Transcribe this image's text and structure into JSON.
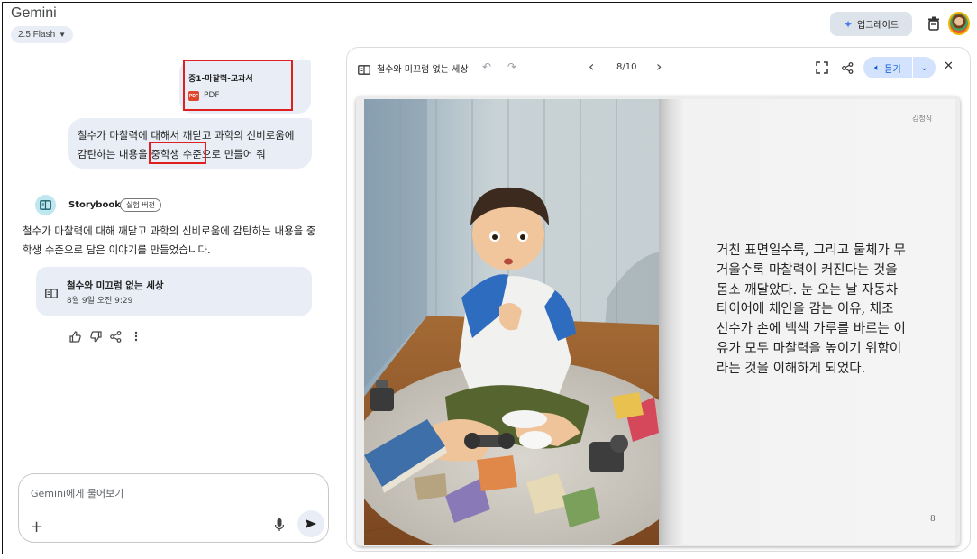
{
  "header": {
    "app_title": "Gemini",
    "model": "2.5 Flash",
    "upgrade_label": "업그레이드"
  },
  "chat": {
    "attachment": {
      "name": "중1-마찰력-교과서",
      "type": "PDF"
    },
    "user_prompt": "철수가 마찰력에 대해서 깨닫고 과학의 신비로움에 감탄하는 내용을 중학생 수준으로 만들어 줘",
    "assistant_name": "Storybook",
    "assistant_badge": "실험 버전",
    "response": "철수가 마찰력에 대해 깨닫고 과학의 신비로움에 감탄하는 내용을 중학생 수준으로 담은 이야기를 만들었습니다.",
    "story_card": {
      "title": "철수와 미끄럼 없는 세상",
      "date": "8월 9일 오전 9:29"
    },
    "input_placeholder": "Gemini에게 물어보기"
  },
  "viewer": {
    "story_title": "철수와 미끄럼 없는 세상",
    "page_indicator": "8/10",
    "listen_label": "듣기",
    "author": "김정식",
    "page_text": "거친 표면일수록, 그리고 물체가 무거울수록 마찰력이 커진다는 것을 몸소 깨달았다. 눈 오는 날 자동차 타이어에 체인을 감는 이유, 체조 선수가 손에 백색 가루를 바르는 이유가 모두 마찰력을 높이기 위함이라는 것을 이해하게 되었다.",
    "page_number": "8"
  },
  "colors": {
    "bubble": "#e9eef6",
    "highlight_box": "#e02020",
    "listen_bg": "#d3e3fd",
    "listen_text": "#0b57d0"
  }
}
